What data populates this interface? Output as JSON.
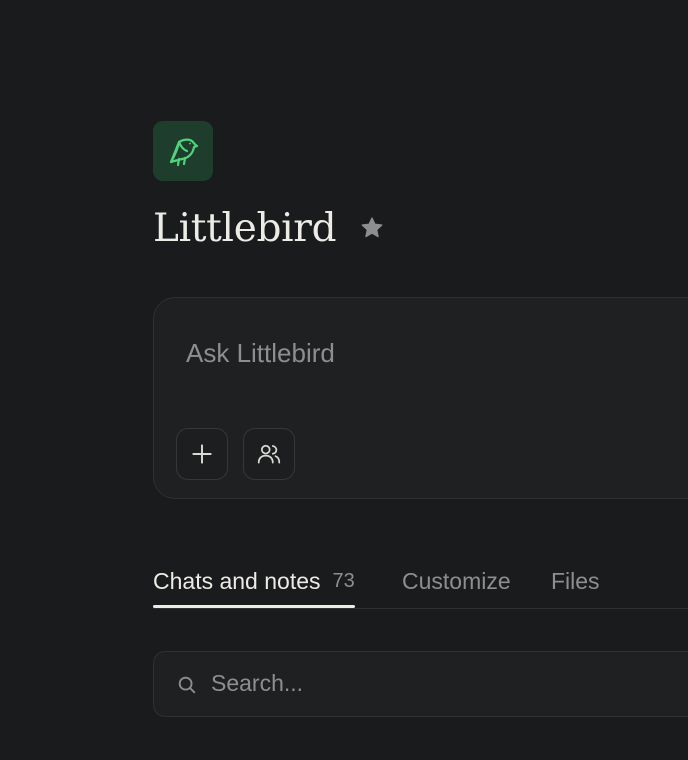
{
  "app": {
    "title": "Littlebird",
    "logo_icon": "bird-icon",
    "favorite_icon": "star-icon",
    "colors": {
      "background": "#1a1b1c",
      "logo_bg": "#1f3d2c",
      "logo_accent": "#4fd47c",
      "text": "#ecebe6",
      "muted": "#8d8e8f"
    }
  },
  "composer": {
    "placeholder": "Ask Littlebird",
    "value": "",
    "buttons": [
      {
        "icon": "plus-icon"
      },
      {
        "icon": "people-icon"
      }
    ]
  },
  "tabs": {
    "items": [
      {
        "label": "Chats and notes",
        "count": "73",
        "active": true
      },
      {
        "label": "Customize",
        "active": false
      },
      {
        "label": "Files",
        "active": false
      }
    ]
  },
  "search": {
    "placeholder": "Search...",
    "value": "",
    "icon": "search-icon"
  }
}
